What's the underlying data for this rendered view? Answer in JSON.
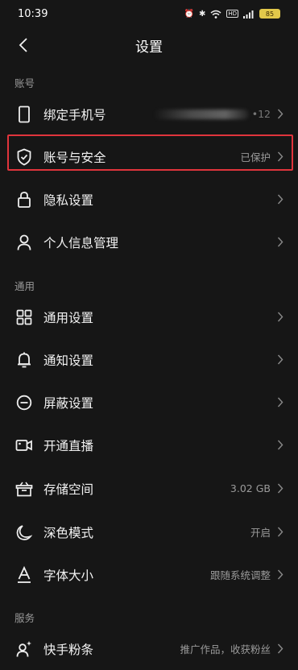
{
  "status_bar": {
    "time": "10:39",
    "battery": "85"
  },
  "header": {
    "title": "设置"
  },
  "sections": {
    "account": "账号",
    "general": "通用",
    "service": "服务"
  },
  "rows": {
    "bind_phone": {
      "label": "绑定手机号",
      "value": "•12",
      "icon": "phone-icon"
    },
    "account_security": {
      "label": "账号与安全",
      "value": "已保护",
      "icon": "shield-check-icon"
    },
    "privacy": {
      "label": "隐私设置",
      "icon": "lock-icon"
    },
    "personal_info": {
      "label": "个人信息管理",
      "icon": "person-icon"
    },
    "general_settings": {
      "label": "通用设置",
      "icon": "grid-icon"
    },
    "notification": {
      "label": "通知设置",
      "icon": "bell-icon"
    },
    "block": {
      "label": "屏蔽设置",
      "icon": "block-icon"
    },
    "live": {
      "label": "开通直播",
      "icon": "video-icon"
    },
    "storage": {
      "label": "存储空间",
      "value": "3.02 GB",
      "icon": "storage-box-icon"
    },
    "dark_mode": {
      "label": "深色模式",
      "value": "开启",
      "icon": "moon-icon"
    },
    "font_size": {
      "label": "字体大小",
      "value": "跟随系统调整",
      "icon": "font-size-icon"
    },
    "kuaishou_fans": {
      "label": "快手粉条",
      "value": "推广作品，收获粉丝",
      "icon": "sparkle-person-icon"
    }
  },
  "colors": {
    "background": "#161616",
    "highlight_border": "#e0343c",
    "battery": "#e2c84a"
  }
}
